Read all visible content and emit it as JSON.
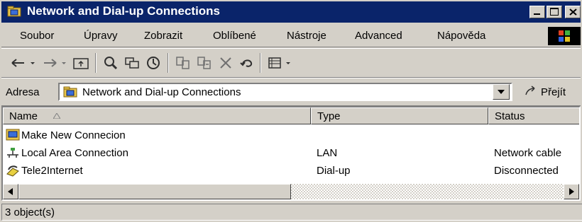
{
  "window": {
    "title": "Network and Dial-up Connections",
    "controls": {
      "minimize": "_",
      "maximize": "□",
      "close": "X"
    }
  },
  "menu": [
    "Soubor",
    "Úpravy",
    "Zobrazit",
    "Oblíbené",
    "Nástroje",
    "Advanced",
    "Nápověda"
  ],
  "toolbar": {
    "icons": [
      "back-icon",
      "forward-icon",
      "up-folder-icon",
      "search-icon",
      "folders-icon",
      "history-icon",
      "move-to-icon",
      "copy-to-icon",
      "delete-icon",
      "undo-icon",
      "views-icon"
    ]
  },
  "address": {
    "label": "Adresa",
    "value": "Network and Dial-up Connections",
    "go_label": "Přejít"
  },
  "list": {
    "columns": [
      {
        "label": "Name",
        "sort": "ascending"
      },
      {
        "label": "Type"
      },
      {
        "label": "Status"
      }
    ],
    "rows": [
      {
        "name": "Make New Connecion",
        "type": "",
        "status": "",
        "icon": "new-connection-icon"
      },
      {
        "name": "Local Area Connection",
        "type": "LAN",
        "status": "Network cable",
        "icon": "lan-icon"
      },
      {
        "name": "Tele2Internet",
        "type": "Dial-up",
        "status": "Disconnected",
        "icon": "dialup-icon"
      }
    ]
  },
  "status": {
    "text": "3 object(s)"
  }
}
